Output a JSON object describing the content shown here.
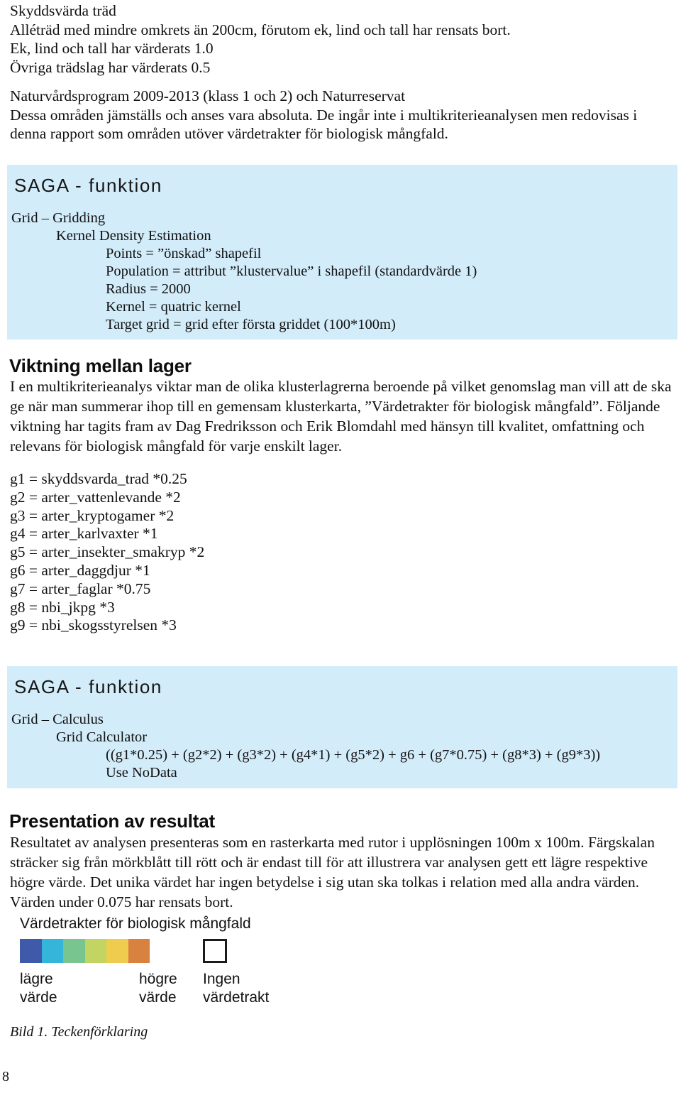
{
  "intro": {
    "lines": [
      "Skyddsvärda träd",
      "Alléträd med mindre omkrets än 200cm, förutom ek, lind och tall har rensats bort.",
      "Ek, lind och tall har värderats 1.0",
      "Övriga trädslag har värderats 0.5"
    ]
  },
  "naturvard": {
    "lines": [
      "Naturvårdsprogram 2009-2013 (klass 1 och 2) och Naturreservat",
      "Dessa områden jämställs och anses vara absoluta. De ingår inte i multikriterieanalysen men redovisas i denna rapport som områden utöver värdetrakter för biologisk mångfald."
    ]
  },
  "saga_panel_1": {
    "title": "SAGA - funktion",
    "lines": [
      {
        "level": 0,
        "text": "Grid – Gridding"
      },
      {
        "level": 1,
        "text": "Kernel Density Estimation"
      },
      {
        "level": 2,
        "text": "Points = ”önskad” shapefil"
      },
      {
        "level": 2,
        "text": "Population = attribut ”klustervalue” i shapefil (standardvärde 1)"
      },
      {
        "level": 2,
        "text": "Radius = 2000"
      },
      {
        "level": 2,
        "text": "Kernel = quatric kernel"
      },
      {
        "level": 2,
        "text": "Target grid = grid efter första griddet (100*100m)"
      }
    ]
  },
  "viktning": {
    "heading": "Viktning mellan lager",
    "paragraph": "I en multikriterieanalys viktar man de olika klusterlagrerna beroende på vilket genomslag man vill att de ska ge när man summerar ihop till en gemensam klusterkarta, ”Värdetrakter för biologisk mångfald”. Följande viktning har tagits fram av Dag Fredriksson och Erik Blomdahl med hänsyn till kvalitet, omfattning och relevans för biologisk mångfald för varje enskilt lager."
  },
  "weights": [
    "g1 = skyddsvarda_trad *0.25",
    "g2 = arter_vattenlevande *2",
    "g3 = arter_kryptogamer *2",
    "g4 = arter_karlvaxter *1",
    "g5 = arter_insekter_smakryp *2",
    "g6 = arter_daggdjur *1",
    "g7 = arter_faglar *0.75",
    "g8 = nbi_jkpg *3",
    "g9 = nbi_skogsstyrelsen *3"
  ],
  "saga_panel_2": {
    "title": "SAGA - funktion",
    "lines": [
      {
        "level": 0,
        "text": "Grid – Calculus"
      },
      {
        "level": 1,
        "text": "Grid Calculator"
      },
      {
        "level": 2,
        "text": "((g1*0.25) + (g2*2) + (g3*2) + (g4*1) + (g5*2) + g6 + (g7*0.75) + (g8*3) + (g9*3))"
      },
      {
        "level": 2,
        "text": "Use NoData"
      }
    ]
  },
  "presentation": {
    "heading": "Presentation av resultat",
    "paragraph": "Resultatet av analysen presenteras som en rasterkarta med rutor i upplösningen 100m x 100m. Färgskalan sträcker sig från mörkblått till rött och är endast till för att illustrera var analysen gett ett lägre respektive högre värde. Det unika värdet har ingen betydelse i sig utan ska tolkas i relation med alla andra värden. Värden under 0.075 har rensats bort."
  },
  "legend": {
    "title": "Värdetrakter för biologisk mångfald",
    "ramp_colors": [
      "#3f5aa8",
      "#35b5da",
      "#78c58f",
      "#c2d563",
      "#f0cc4e",
      "#d9813f"
    ],
    "nodata_fill": "#ffffff",
    "nodata_border": "#1b1b1b",
    "label_low": "lägre\nvärde",
    "label_high": "högre\nvärde",
    "label_nodata": "Ingen\nvärdetrakt"
  },
  "figure_caption": "Bild 1. Teckenförklaring",
  "page_number": "8"
}
